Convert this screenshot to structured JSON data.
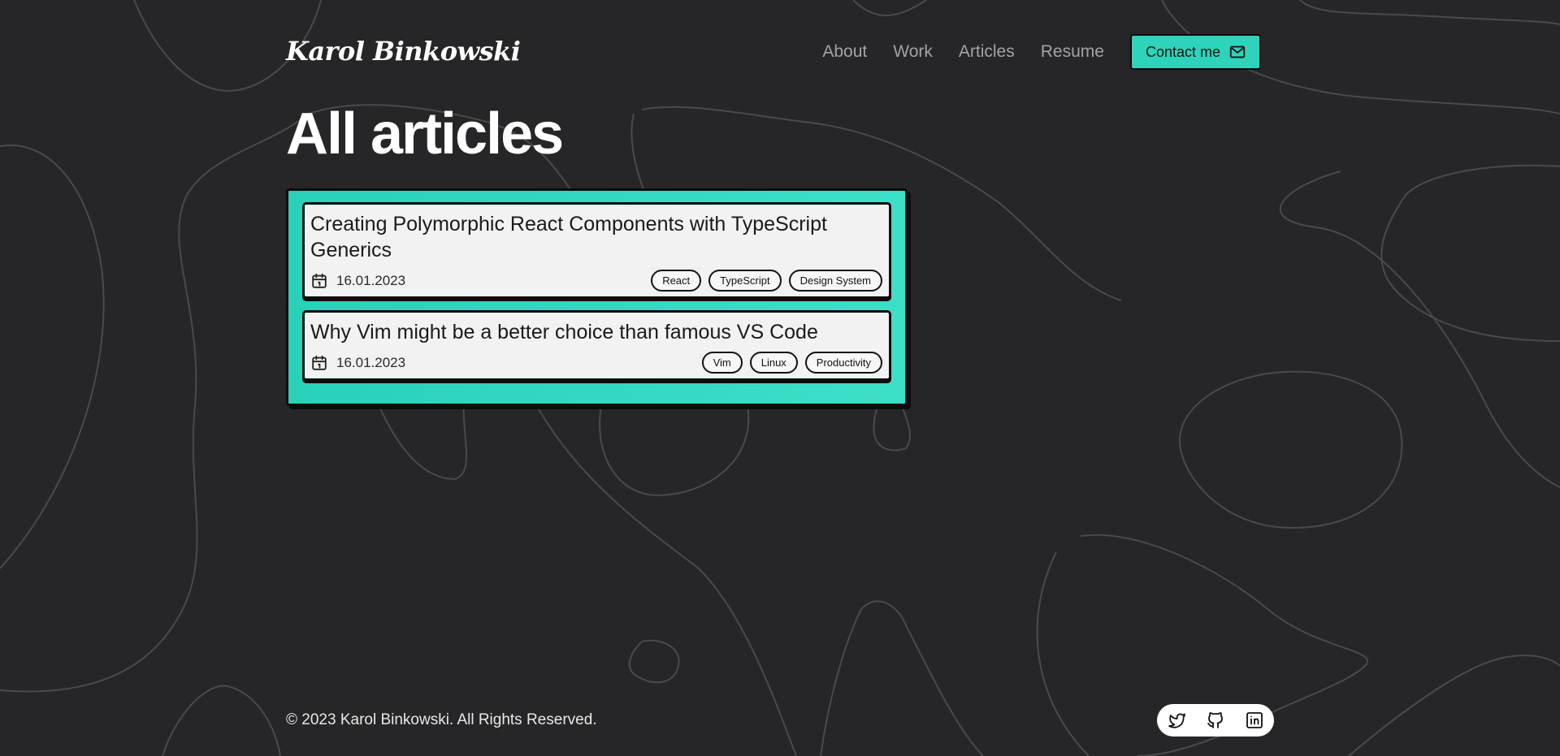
{
  "header": {
    "logo": "Karol Binkowski",
    "nav": [
      {
        "label": "About"
      },
      {
        "label": "Work"
      },
      {
        "label": "Articles"
      },
      {
        "label": "Resume"
      }
    ],
    "contact_label": "Contact me",
    "contact_icon": "mail-icon"
  },
  "main": {
    "title": "All articles",
    "accent_color": "#2ed3bb",
    "articles": [
      {
        "title": "Creating Polymorphic React Components with TypeScript Generics",
        "date": "16.01.2023",
        "tags": [
          "React",
          "TypeScript",
          "Design System"
        ]
      },
      {
        "title": "Why Vim might be a better choice than famous VS Code",
        "date": "16.01.2023",
        "tags": [
          "Vim",
          "Linux",
          "Productivity"
        ]
      }
    ]
  },
  "footer": {
    "copyright": "© 2023 Karol Binkowski. All Rights Reserved.",
    "social_icons": [
      "twitter-icon",
      "github-icon",
      "linkedin-icon"
    ]
  }
}
